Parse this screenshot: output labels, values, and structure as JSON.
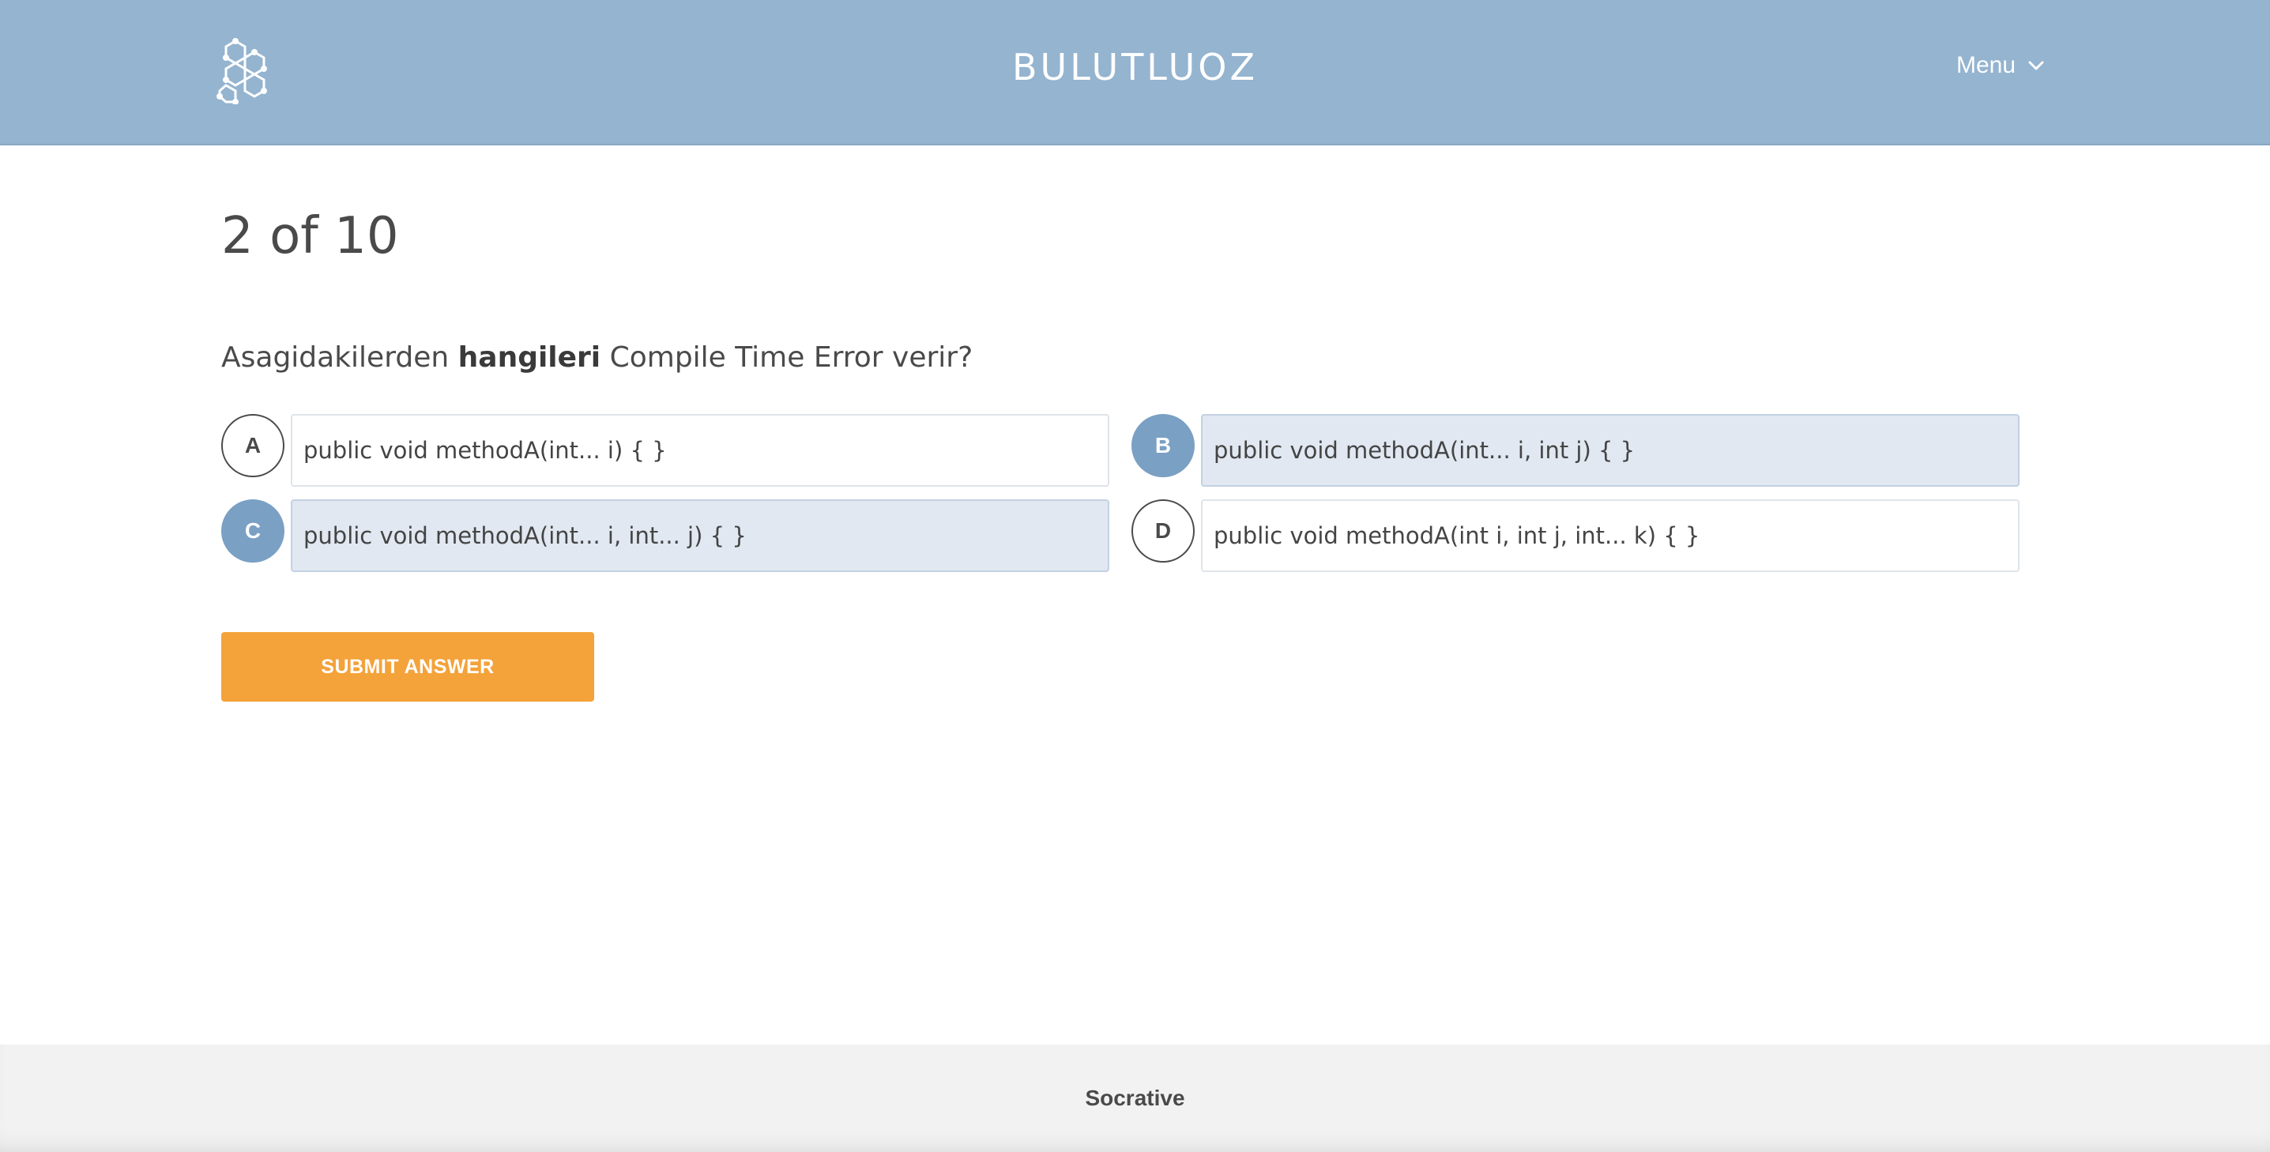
{
  "header": {
    "logo_icon": "hexagon-molecule-icon",
    "title": "BULUTLUOZ",
    "menu_label": "Menu",
    "menu_icon": "chevron-down-icon",
    "background_color": "#94b4d0"
  },
  "quiz": {
    "progress": "2 of 10",
    "question": {
      "prefix": "Asagidakilerden ",
      "bold": "hangileri",
      "suffix": " Compile Time Error verir?"
    },
    "options": [
      {
        "letter": "A",
        "text": "public void methodA(int... i) { }",
        "selected": false
      },
      {
        "letter": "B",
        "text": "public void methodA(int... i, int j) { }",
        "selected": true
      },
      {
        "letter": "C",
        "text": "public void methodA(int... i, int... j) { }",
        "selected": true
      },
      {
        "letter": "D",
        "text": "public void methodA(int i, int j, int... k) { }",
        "selected": false
      }
    ],
    "submit_label": "SUBMIT ANSWER",
    "submit_color": "#f4a23a",
    "selected_color": "#7aa0c4"
  },
  "footer": {
    "brand": "Socrative"
  }
}
